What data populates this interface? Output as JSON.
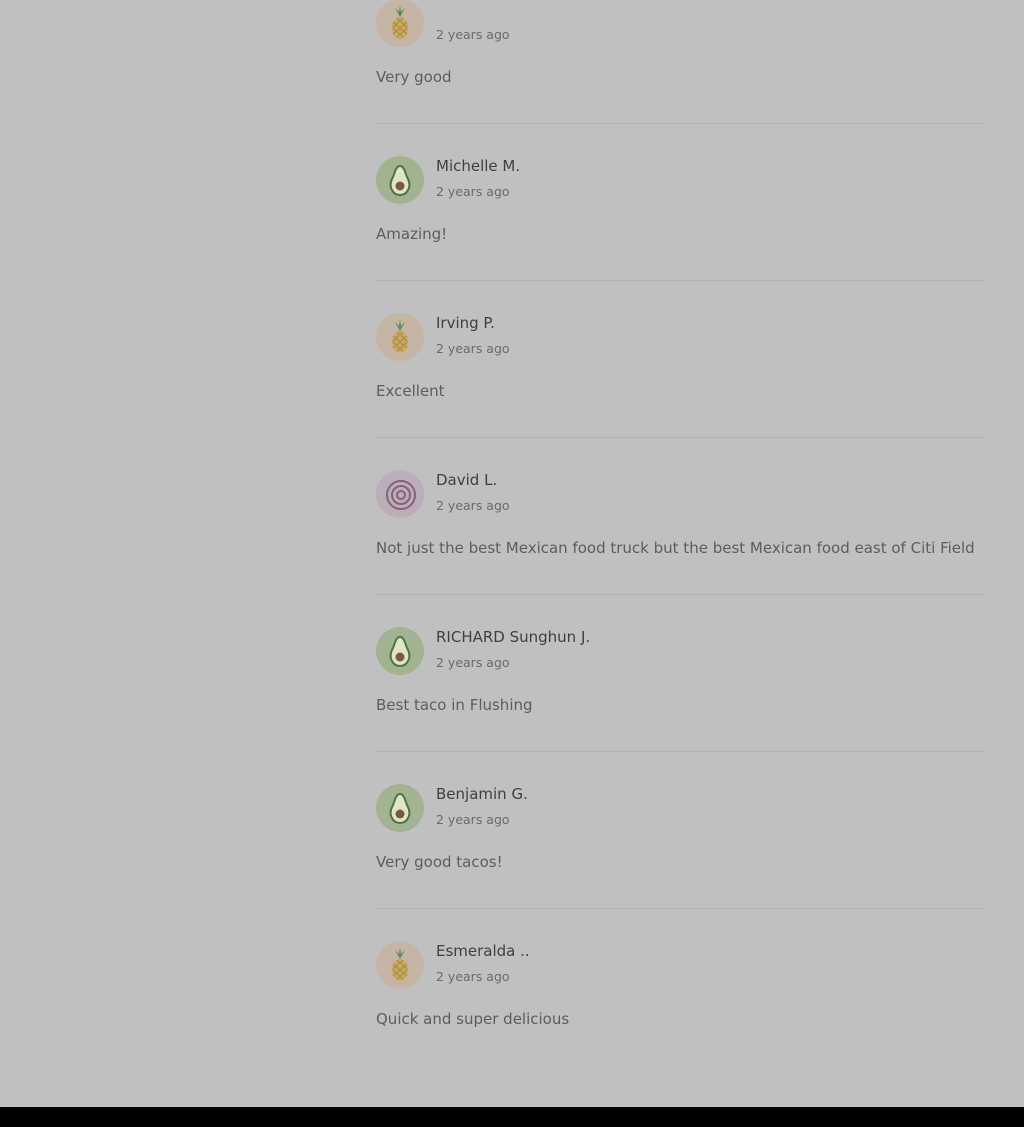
{
  "reviews": [
    {
      "name": "",
      "time": "2 years ago",
      "text": "Very good",
      "avatar": "pineapple-icon"
    },
    {
      "name": "Michelle M.",
      "time": "2 years ago",
      "text": "Amazing!",
      "avatar": "avocado-icon"
    },
    {
      "name": "Irving P.",
      "time": "2 years ago",
      "text": "Excellent",
      "avatar": "pineapple-icon"
    },
    {
      "name": "David L.",
      "time": "2 years ago",
      "text": "Not just the best Mexican food truck but the best Mexican food east of Citi Field",
      "avatar": "onion-icon"
    },
    {
      "name": "RICHARD Sunghun J.",
      "time": "2 years ago",
      "text": "Best taco in Flushing",
      "avatar": "avocado-icon"
    },
    {
      "name": "Benjamin G.",
      "time": "2 years ago",
      "text": "Very good tacos!",
      "avatar": "avocado-icon"
    },
    {
      "name": "Esmeralda ..",
      "time": "2 years ago",
      "text": "Quick and super delicious",
      "avatar": "pineapple-icon"
    }
  ],
  "colors": {
    "overlay_background": "#c0c0c0",
    "divider": "#b2b2b2",
    "avocado_bg": "#a2b392",
    "pineapple_bg": "#c4b5a5",
    "onion_bg": "#bcaeb8",
    "footer_bar": "#000000"
  }
}
